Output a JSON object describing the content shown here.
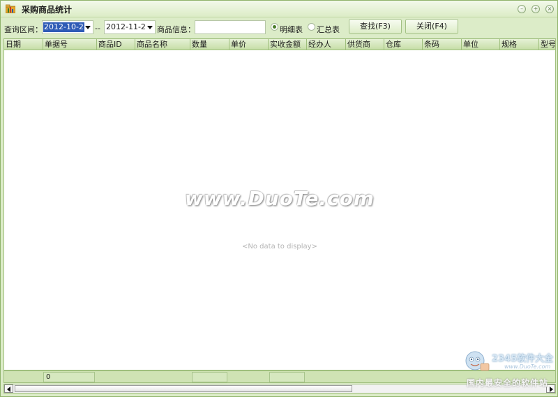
{
  "window": {
    "title": "采购商品统计"
  },
  "toolbar": {
    "range_label": "查询区间：",
    "start_date": "2012-10-2",
    "separator": "--",
    "end_date": "2012-11-2",
    "info_label": "商品信息：",
    "info_value": "",
    "radio_detail_label": "明细表",
    "radio_summary_label": "汇总表",
    "selected_view": "明细表",
    "find_button": "查找(F3)",
    "close_button": "关闭(F4)"
  },
  "grid": {
    "columns": [
      "日期",
      "单据号",
      "商品ID",
      "商品名称",
      "数量",
      "单价",
      "实收金额",
      "经办人",
      "供货商",
      "仓库",
      "条码",
      "单位",
      "规格",
      "型号"
    ],
    "rows": [],
    "empty_text": "<No data to display>"
  },
  "footer": {
    "count": "0"
  },
  "watermark": {
    "site": "www.DuoTe.com",
    "brand": "2345软件大全",
    "brand_url": "www.DuoTe.com",
    "slogan": "国内最安全的软件站"
  },
  "colors": {
    "frame": "#dcecc8",
    "header": "#c6dea7",
    "selection": "#2f5bb6"
  }
}
